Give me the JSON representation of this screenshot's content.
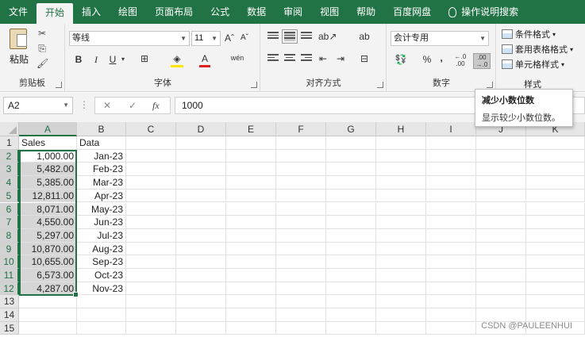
{
  "tabs": [
    "文件",
    "开始",
    "插入",
    "绘图",
    "页面布局",
    "公式",
    "数据",
    "审阅",
    "视图",
    "帮助",
    "百度网盘"
  ],
  "active_tab_index": 1,
  "search_label": "操作说明搜索",
  "ribbon": {
    "clipboard": {
      "paste_label": "粘贴",
      "group_label": "剪贴板"
    },
    "font": {
      "font_name": "等线",
      "font_size": "11",
      "bold": "B",
      "italic": "I",
      "underline": "U",
      "grow": "Aˆ",
      "shrink": "Aˇ",
      "font_color": "A",
      "phonetic": "wén",
      "group_label": "字体"
    },
    "alignment": {
      "wrap": "ab",
      "group_label": "对齐方式"
    },
    "number": {
      "format": "会计专用",
      "percent": "%",
      "comma": ",",
      "inc_decimal": "←.0\n.00",
      "dec_decimal": ".00\n→.0",
      "group_label": "数字"
    },
    "styles": {
      "conditional": "条件格式",
      "table": "套用表格格式",
      "cell": "单元格样式",
      "group_label": "样式"
    }
  },
  "tooltip": {
    "title": "减少小数位数",
    "desc": "显示较少小数位数。"
  },
  "formula_bar": {
    "name_box": "A2",
    "fx": "fx",
    "cancel": "✕",
    "enter": "✓",
    "value": "1000"
  },
  "columns": [
    "A",
    "B",
    "C",
    "D",
    "E",
    "F",
    "G",
    "H",
    "I",
    "J",
    "K"
  ],
  "rows": [
    "1",
    "2",
    "3",
    "4",
    "5",
    "6",
    "7",
    "8",
    "9",
    "10",
    "11",
    "12",
    "13",
    "14",
    "15"
  ],
  "headers": {
    "a": "Sales",
    "b": "Data"
  },
  "data": [
    {
      "sales": "1,000.00",
      "date": "Jan-23"
    },
    {
      "sales": "5,482.00",
      "date": "Feb-23"
    },
    {
      "sales": "5,385.00",
      "date": "Mar-23"
    },
    {
      "sales": "12,811.00",
      "date": "Apr-23"
    },
    {
      "sales": "8,071.00",
      "date": "May-23"
    },
    {
      "sales": "4,550.00",
      "date": "Jun-23"
    },
    {
      "sales": "5,297.00",
      "date": "Jul-23"
    },
    {
      "sales": "10,870.00",
      "date": "Aug-23"
    },
    {
      "sales": "10,655.00",
      "date": "Sep-23"
    },
    {
      "sales": "6,573.00",
      "date": "Oct-23"
    },
    {
      "sales": "4,287.00",
      "date": "Nov-23"
    }
  ],
  "watermark": "CSDN @PAULEENHUI",
  "colors": {
    "accent": "#217346",
    "selection": "#d6d6d6"
  }
}
